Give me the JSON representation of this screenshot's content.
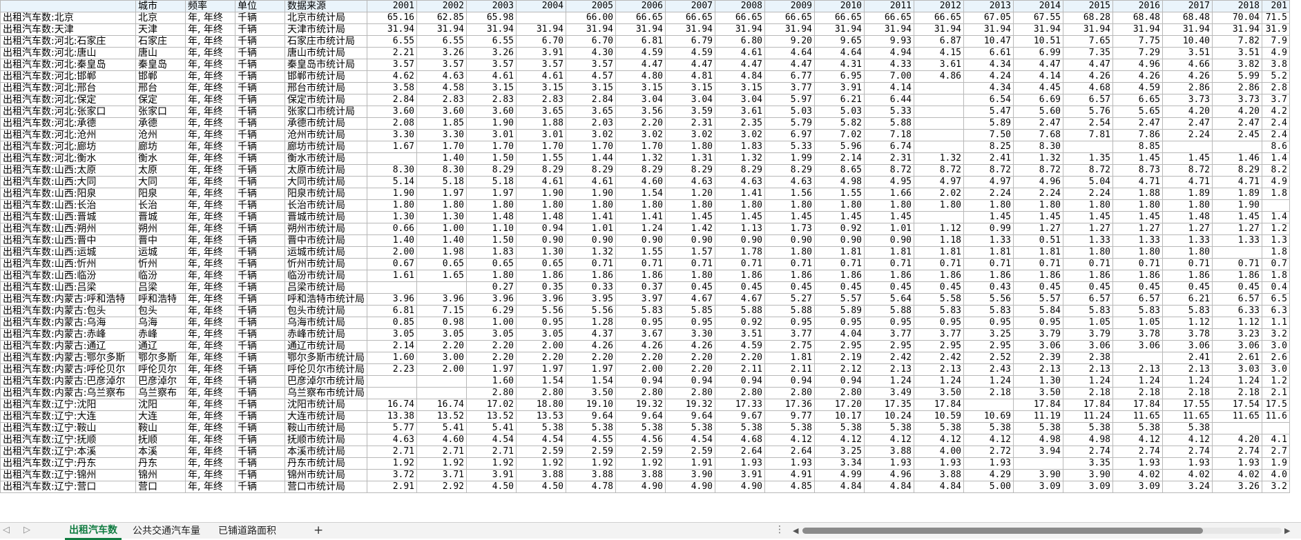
{
  "table": {
    "headers": [
      "",
      "城市",
      "频率",
      "单位",
      "数据来源",
      "2001",
      "2002",
      "2003",
      "2004",
      "2005",
      "2006",
      "2007",
      "2008",
      "2009",
      "2010",
      "2011",
      "2012",
      "2013",
      "2014",
      "2015",
      "2016",
      "2017",
      "2018",
      "201"
    ],
    "rows": [
      [
        "出租汽车数:北京",
        "北京",
        "年, 年终",
        "千辆",
        "北京市统计局",
        "65.16",
        "62.85",
        "65.98",
        "",
        "66.00",
        "66.65",
        "66.65",
        "66.65",
        "66.65",
        "66.65",
        "66.65",
        "66.65",
        "67.05",
        "67.55",
        "68.28",
        "68.48",
        "68.48",
        "70.04",
        "71.5"
      ],
      [
        "出租汽车数:天津",
        "天津",
        "年, 年终",
        "千辆",
        "天津市统计局",
        "31.94",
        "31.94",
        "31.94",
        "31.94",
        "31.94",
        "31.94",
        "31.94",
        "31.94",
        "31.94",
        "31.94",
        "31.94",
        "31.94",
        "31.94",
        "31.94",
        "31.94",
        "31.94",
        "31.94",
        "31.94",
        "31.9"
      ],
      [
        "出租汽车数:河北:石家庄",
        "石家庄",
        "年, 年终",
        "千辆",
        "石家庄市统计局",
        "6.55",
        "6.55",
        "6.55",
        "6.70",
        "6.70",
        "6.81",
        "6.79",
        "6.80",
        "9.20",
        "9.65",
        "9.93",
        "6.87",
        "10.47",
        "10.51",
        "7.65",
        "7.75",
        "10.40",
        "7.82",
        "7.9"
      ],
      [
        "出租汽车数:河北:唐山",
        "唐山",
        "年, 年终",
        "千辆",
        "唐山市统计局",
        "2.21",
        "3.26",
        "3.26",
        "3.91",
        "4.30",
        "4.59",
        "4.59",
        "4.61",
        "4.64",
        "4.64",
        "4.94",
        "4.15",
        "6.61",
        "6.99",
        "7.35",
        "7.29",
        "3.51",
        "3.51",
        "4.9"
      ],
      [
        "出租汽车数:河北:秦皇岛",
        "秦皇岛",
        "年, 年终",
        "千辆",
        "秦皇岛市统计局",
        "3.57",
        "3.57",
        "3.57",
        "3.57",
        "3.57",
        "4.47",
        "4.47",
        "4.47",
        "4.47",
        "4.31",
        "4.33",
        "3.61",
        "4.34",
        "4.47",
        "4.47",
        "4.96",
        "4.66",
        "3.82",
        "3.8"
      ],
      [
        "出租汽车数:河北:邯郸",
        "邯郸",
        "年, 年终",
        "千辆",
        "邯郸市统计局",
        "4.62",
        "4.63",
        "4.61",
        "4.61",
        "4.57",
        "4.80",
        "4.81",
        "4.84",
        "6.77",
        "6.95",
        "7.00",
        "4.86",
        "4.24",
        "4.14",
        "4.26",
        "4.26",
        "4.26",
        "5.99",
        "5.2"
      ],
      [
        "出租汽车数:河北:邢台",
        "邢台",
        "年, 年终",
        "千辆",
        "邢台市统计局",
        "3.58",
        "4.58",
        "3.15",
        "3.15",
        "3.15",
        "3.15",
        "3.15",
        "3.15",
        "3.77",
        "3.91",
        "4.14",
        "",
        "4.34",
        "4.45",
        "4.68",
        "4.59",
        "2.86",
        "2.86",
        "2.8"
      ],
      [
        "出租汽车数:河北:保定",
        "保定",
        "年, 年终",
        "千辆",
        "保定市统计局",
        "2.84",
        "2.83",
        "2.83",
        "2.83",
        "2.84",
        "3.04",
        "3.04",
        "3.04",
        "5.97",
        "6.21",
        "6.44",
        "",
        "6.54",
        "6.69",
        "6.57",
        "6.65",
        "3.73",
        "3.73",
        "3.7"
      ],
      [
        "出租汽车数:河北:张家口",
        "张家口",
        "年, 年终",
        "千辆",
        "张家口市统计局",
        "3.60",
        "3.60",
        "3.60",
        "3.65",
        "3.65",
        "3.56",
        "3.59",
        "3.61",
        "5.03",
        "5.03",
        "5.33",
        "",
        "5.47",
        "5.60",
        "5.76",
        "5.65",
        "4.20",
        "4.20",
        "4.2"
      ],
      [
        "出租汽车数:河北:承德",
        "承德",
        "年, 年终",
        "千辆",
        "承德市统计局",
        "2.08",
        "1.85",
        "1.90",
        "1.88",
        "2.03",
        "2.20",
        "2.31",
        "2.35",
        "5.79",
        "5.82",
        "5.88",
        "",
        "5.89",
        "2.47",
        "2.54",
        "2.47",
        "2.47",
        "2.47",
        "2.4"
      ],
      [
        "出租汽车数:河北:沧州",
        "沧州",
        "年, 年终",
        "千辆",
        "沧州市统计局",
        "3.30",
        "3.30",
        "3.01",
        "3.01",
        "3.02",
        "3.02",
        "3.02",
        "3.02",
        "6.97",
        "7.02",
        "7.18",
        "",
        "7.50",
        "7.68",
        "7.81",
        "7.86",
        "2.24",
        "2.45",
        "2.4"
      ],
      [
        "出租汽车数:河北:廊坊",
        "廊坊",
        "年, 年终",
        "千辆",
        "廊坊市统计局",
        "1.67",
        "1.70",
        "1.70",
        "1.70",
        "1.70",
        "1.70",
        "1.80",
        "1.83",
        "5.33",
        "5.96",
        "6.74",
        "",
        "8.25",
        "8.30",
        "",
        "8.85",
        "",
        "",
        "8.6"
      ],
      [
        "出租汽车数:河北:衡水",
        "衡水",
        "年, 年终",
        "千辆",
        "衡水市统计局",
        "",
        "1.40",
        "1.50",
        "1.55",
        "1.44",
        "1.32",
        "1.31",
        "1.32",
        "1.99",
        "2.14",
        "2.31",
        "1.32",
        "2.41",
        "1.32",
        "1.35",
        "1.45",
        "1.45",
        "1.46",
        "1.4"
      ],
      [
        "出租汽车数:山西:太原",
        "太原",
        "年, 年终",
        "千辆",
        "太原市统计局",
        "8.30",
        "8.30",
        "8.29",
        "8.29",
        "8.29",
        "8.29",
        "8.29",
        "8.29",
        "8.29",
        "8.65",
        "8.72",
        "8.72",
        "8.72",
        "8.72",
        "8.72",
        "8.73",
        "8.72",
        "8.29",
        "8.2"
      ],
      [
        "出租汽车数:山西:大同",
        "大同",
        "年, 年终",
        "千辆",
        "大同市统计局",
        "5.14",
        "5.18",
        "5.18",
        "4.61",
        "4.61",
        "4.60",
        "4.63",
        "4.63",
        "4.63",
        "4.98",
        "4.95",
        "4.97",
        "4.97",
        "4.96",
        "5.04",
        "4.71",
        "4.71",
        "4.71",
        "4.9"
      ],
      [
        "出租汽车数:山西:阳泉",
        "阳泉",
        "年, 年终",
        "千辆",
        "阳泉市统计局",
        "1.90",
        "1.97",
        "1.97",
        "1.90",
        "1.90",
        "1.54",
        "1.20",
        "1.41",
        "1.56",
        "1.55",
        "1.66",
        "2.02",
        "2.24",
        "2.24",
        "2.24",
        "1.88",
        "1.89",
        "1.89",
        "1.8"
      ],
      [
        "出租汽车数:山西:长治",
        "长治",
        "年, 年终",
        "千辆",
        "长治市统计局",
        "1.80",
        "1.80",
        "1.80",
        "1.80",
        "1.80",
        "1.80",
        "1.80",
        "1.80",
        "1.80",
        "1.80",
        "1.80",
        "1.80",
        "1.80",
        "1.80",
        "1.80",
        "1.80",
        "1.80",
        "1.90",
        ""
      ],
      [
        "出租汽车数:山西:晋城",
        "晋城",
        "年, 年终",
        "千辆",
        "晋城市统计局",
        "1.30",
        "1.30",
        "1.48",
        "1.48",
        "1.41",
        "1.41",
        "1.45",
        "1.45",
        "1.45",
        "1.45",
        "1.45",
        "",
        "1.45",
        "1.45",
        "1.45",
        "1.45",
        "1.48",
        "1.45",
        "1.4"
      ],
      [
        "出租汽车数:山西:朔州",
        "朔州",
        "年, 年终",
        "千辆",
        "朔州市统计局",
        "0.66",
        "1.00",
        "1.10",
        "0.94",
        "1.01",
        "1.24",
        "1.42",
        "1.13",
        "1.73",
        "0.92",
        "1.01",
        "1.12",
        "0.99",
        "1.27",
        "1.27",
        "1.27",
        "1.27",
        "1.27",
        "1.2"
      ],
      [
        "出租汽车数:山西:晋中",
        "晋中",
        "年, 年终",
        "千辆",
        "晋中市统计局",
        "1.40",
        "1.40",
        "1.50",
        "0.90",
        "0.90",
        "0.90",
        "0.90",
        "0.90",
        "0.90",
        "0.90",
        "0.90",
        "1.18",
        "1.33",
        "0.51",
        "1.33",
        "1.33",
        "1.33",
        "1.33",
        "1.3"
      ],
      [
        "出租汽车数:山西:运城",
        "运城",
        "年, 年终",
        "千辆",
        "运城市统计局",
        "2.00",
        "1.98",
        "1.83",
        "1.30",
        "1.32",
        "1.55",
        "1.57",
        "1.78",
        "1.80",
        "1.81",
        "1.81",
        "1.81",
        "1.81",
        "1.81",
        "1.80",
        "1.80",
        "1.80",
        "",
        "1.8"
      ],
      [
        "出租汽车数:山西:忻州",
        "忻州",
        "年, 年终",
        "千辆",
        "忻州市统计局",
        "0.67",
        "0.65",
        "0.65",
        "0.65",
        "0.71",
        "0.71",
        "0.71",
        "0.71",
        "0.71",
        "0.71",
        "0.71",
        "0.71",
        "0.71",
        "0.71",
        "0.71",
        "0.71",
        "0.71",
        "0.71",
        "0.7"
      ],
      [
        "出租汽车数:山西:临汾",
        "临汾",
        "年, 年终",
        "千辆",
        "临汾市统计局",
        "1.61",
        "1.65",
        "1.80",
        "1.86",
        "1.86",
        "1.86",
        "1.80",
        "1.86",
        "1.86",
        "1.86",
        "1.86",
        "1.86",
        "1.86",
        "1.86",
        "1.86",
        "1.86",
        "1.86",
        "1.86",
        "1.8"
      ],
      [
        "出租汽车数:山西:吕梁",
        "吕梁",
        "年, 年终",
        "千辆",
        "吕梁市统计局",
        "",
        "",
        "0.27",
        "0.35",
        "0.33",
        "0.37",
        "0.45",
        "0.45",
        "0.45",
        "0.45",
        "0.45",
        "0.45",
        "0.43",
        "0.45",
        "0.45",
        "0.45",
        "0.45",
        "0.45",
        "0.4"
      ],
      [
        "出租汽车数:内蒙古:呼和浩特",
        "呼和浩特",
        "年, 年终",
        "千辆",
        "呼和浩特市统计局",
        "3.96",
        "3.96",
        "3.96",
        "3.96",
        "3.95",
        "3.97",
        "4.67",
        "4.67",
        "5.27",
        "5.57",
        "5.64",
        "5.58",
        "5.56",
        "5.57",
        "6.57",
        "6.57",
        "6.21",
        "6.57",
        "6.5"
      ],
      [
        "出租汽车数:内蒙古:包头",
        "包头",
        "年, 年终",
        "千辆",
        "包头市统计局",
        "6.81",
        "7.15",
        "6.29",
        "5.56",
        "5.56",
        "5.83",
        "5.85",
        "5.88",
        "5.88",
        "5.89",
        "5.88",
        "5.83",
        "5.83",
        "5.84",
        "5.83",
        "5.83",
        "5.83",
        "6.33",
        "6.3"
      ],
      [
        "出租汽车数:内蒙古:乌海",
        "乌海",
        "年, 年终",
        "千辆",
        "乌海市统计局",
        "0.85",
        "0.98",
        "1.00",
        "0.95",
        "1.28",
        "0.95",
        "0.95",
        "0.92",
        "0.95",
        "0.95",
        "0.95",
        "0.95",
        "0.95",
        "0.95",
        "1.05",
        "1.05",
        "1.12",
        "1.12",
        "1.1"
      ],
      [
        "出租汽车数:内蒙古:赤峰",
        "赤峰",
        "年, 年终",
        "千辆",
        "赤峰市统计局",
        "3.05",
        "3.05",
        "3.05",
        "3.05",
        "4.37",
        "3.67",
        "3.30",
        "3.51",
        "3.77",
        "4.04",
        "3.77",
        "3.77",
        "3.25",
        "3.79",
        "3.79",
        "3.78",
        "3.78",
        "3.23",
        "3.2"
      ],
      [
        "出租汽车数:内蒙古:通辽",
        "通辽",
        "年, 年终",
        "千辆",
        "通辽市统计局",
        "2.14",
        "2.20",
        "2.20",
        "2.00",
        "4.26",
        "4.26",
        "4.26",
        "4.59",
        "2.75",
        "2.95",
        "2.95",
        "2.95",
        "2.95",
        "3.06",
        "3.06",
        "3.06",
        "3.06",
        "3.06",
        "3.0"
      ],
      [
        "出租汽车数:内蒙古:鄂尔多斯",
        "鄂尔多斯",
        "年, 年终",
        "千辆",
        "鄂尔多斯市统计局",
        "1.60",
        "3.00",
        "2.20",
        "2.20",
        "2.20",
        "2.20",
        "2.20",
        "2.20",
        "1.81",
        "2.19",
        "2.42",
        "2.42",
        "2.52",
        "2.39",
        "2.38",
        "",
        "2.41",
        "2.61",
        "2.6"
      ],
      [
        "出租汽车数:内蒙古:呼伦贝尔",
        "呼伦贝尔",
        "年, 年终",
        "千辆",
        "呼伦贝尔市统计局",
        "2.23",
        "2.00",
        "1.97",
        "1.97",
        "1.97",
        "2.00",
        "2.20",
        "2.11",
        "2.11",
        "2.12",
        "2.13",
        "2.13",
        "2.43",
        "2.13",
        "2.13",
        "2.13",
        "2.13",
        "3.03",
        "3.0"
      ],
      [
        "出租汽车数:内蒙古:巴彦淖尔",
        "巴彦淖尔",
        "年, 年终",
        "千辆",
        "巴彦淖尔市统计局",
        "",
        "",
        "1.60",
        "1.54",
        "1.54",
        "0.94",
        "0.94",
        "0.94",
        "0.94",
        "0.94",
        "1.24",
        "1.24",
        "1.24",
        "1.30",
        "1.24",
        "1.24",
        "1.24",
        "1.24",
        "1.2"
      ],
      [
        "出租汽车数:内蒙古:乌兰察布",
        "乌兰察布",
        "年, 年终",
        "千辆",
        "乌兰察布市统计局",
        "",
        "",
        "2.80",
        "2.80",
        "3.50",
        "2.80",
        "2.80",
        "2.80",
        "2.80",
        "2.80",
        "3.49",
        "3.50",
        "2.18",
        "3.50",
        "2.18",
        "2.18",
        "2.18",
        "2.18",
        "2.1"
      ],
      [
        "出租汽车数:辽宁:沈阳",
        "沈阳",
        "年, 年终",
        "千辆",
        "沈阳市统计局",
        "16.74",
        "16.74",
        "17.02",
        "18.80",
        "19.10",
        "19.32",
        "19.32",
        "17.33",
        "17.36",
        "17.20",
        "17.35",
        "17.84",
        "",
        "17.84",
        "17.84",
        "17.84",
        "17.55",
        "17.54",
        "17.5"
      ],
      [
        "出租汽车数:辽宁:大连",
        "大连",
        "年, 年终",
        "千辆",
        "大连市统计局",
        "13.38",
        "13.52",
        "13.52",
        "13.53",
        "9.64",
        "9.64",
        "9.64",
        "9.67",
        "9.77",
        "10.17",
        "10.24",
        "10.59",
        "10.69",
        "11.19",
        "11.24",
        "11.65",
        "11.65",
        "11.65",
        "11.6"
      ],
      [
        "出租汽车数:辽宁:鞍山",
        "鞍山",
        "年, 年终",
        "千辆",
        "鞍山市统计局",
        "5.77",
        "5.41",
        "5.41",
        "5.38",
        "5.38",
        "5.38",
        "5.38",
        "5.38",
        "5.38",
        "5.38",
        "5.38",
        "5.38",
        "5.38",
        "5.38",
        "5.38",
        "5.38",
        "5.38",
        "",
        ""
      ],
      [
        "出租汽车数:辽宁:抚顺",
        "抚顺",
        "年, 年终",
        "千辆",
        "抚顺市统计局",
        "4.63",
        "4.60",
        "4.54",
        "4.54",
        "4.55",
        "4.56",
        "4.54",
        "4.68",
        "4.12",
        "4.12",
        "4.12",
        "4.12",
        "4.12",
        "4.98",
        "4.98",
        "4.12",
        "4.12",
        "4.20",
        "4.1"
      ],
      [
        "出租汽车数:辽宁:本溪",
        "本溪",
        "年, 年终",
        "千辆",
        "本溪市统计局",
        "2.71",
        "2.71",
        "2.71",
        "2.59",
        "2.59",
        "2.59",
        "2.59",
        "2.64",
        "2.64",
        "3.25",
        "3.88",
        "4.00",
        "2.72",
        "3.94",
        "2.74",
        "2.74",
        "2.74",
        "2.74",
        "2.7"
      ],
      [
        "出租汽车数:辽宁:丹东",
        "丹东",
        "年, 年终",
        "千辆",
        "丹东市统计局",
        "1.92",
        "1.92",
        "1.92",
        "1.92",
        "1.92",
        "1.92",
        "1.91",
        "1.93",
        "1.93",
        "3.34",
        "1.93",
        "1.93",
        "1.93",
        "",
        "3.35",
        "1.93",
        "1.93",
        "1.93",
        "1.9"
      ],
      [
        "出租汽车数:辽宁:锦州",
        "锦州",
        "年, 年终",
        "千辆",
        "锦州市统计局",
        "3.72",
        "3.71",
        "3.91",
        "3.88",
        "3.88",
        "3.88",
        "3.90",
        "3.91",
        "4.91",
        "4.99",
        "4.96",
        "3.88",
        "4.29",
        "3.90",
        "3.90",
        "4.02",
        "4.02",
        "4.02",
        "4.0"
      ],
      [
        "出租汽车数:辽宁:营口",
        "营口",
        "年, 年终",
        "千辆",
        "营口市统计局",
        "2.91",
        "2.92",
        "4.50",
        "4.50",
        "4.78",
        "4.90",
        "4.90",
        "4.90",
        "4.85",
        "4.84",
        "4.84",
        "4.84",
        "5.00",
        "3.09",
        "3.09",
        "3.09",
        "3.24",
        "3.26",
        "3.2"
      ]
    ]
  },
  "sheet_tabs": [
    "出租汽车数",
    "公共交通汽车量",
    "已铺道路面积"
  ],
  "active_tab": 0,
  "icons": {
    "prev_sheet": "◁",
    "next_sheet": "▷",
    "add_sheet": "+",
    "more_menu": "⋮",
    "scroll_left": "◀",
    "scroll_right": "▶"
  },
  "colors": {
    "header_bg": "#eaf4fb",
    "active_tab": "#107c41",
    "grid_line": "#b8b8b8"
  }
}
